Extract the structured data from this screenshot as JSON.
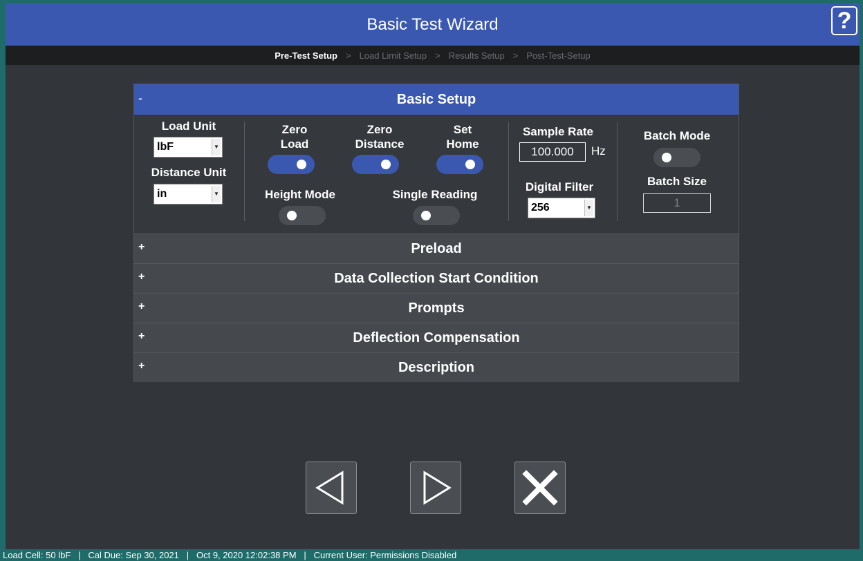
{
  "window": {
    "title": "Basic Test Wizard",
    "help_label": "?"
  },
  "breadcrumb": {
    "steps": [
      "Pre-Test Setup",
      "Load Limit Setup",
      "Results Setup",
      "Post-Test-Setup"
    ],
    "active_index": 0,
    "separator": ">"
  },
  "basic_setup": {
    "header": "Basic Setup",
    "toggle": "-",
    "load_unit": {
      "label": "Load Unit",
      "value": "lbF"
    },
    "distance_unit": {
      "label": "Distance Unit",
      "value": "in"
    },
    "zero_load": {
      "label_line1": "Zero",
      "label_line2": "Load",
      "on": true
    },
    "zero_distance": {
      "label_line1": "Zero",
      "label_line2": "Distance",
      "on": true
    },
    "set_home": {
      "label_line1": "Set",
      "label_line2": "Home",
      "on": true
    },
    "height_mode": {
      "label": "Height Mode",
      "on": false
    },
    "single_reading": {
      "label": "Single Reading",
      "on": false
    },
    "sample_rate": {
      "label": "Sample Rate",
      "value": "100.000",
      "unit": "Hz"
    },
    "digital_filter": {
      "label": "Digital Filter",
      "value": "256"
    },
    "batch_mode": {
      "label": "Batch Mode",
      "on": false
    },
    "batch_size": {
      "label": "Batch Size",
      "value": "1"
    }
  },
  "sections": [
    {
      "toggle": "+",
      "label": "Preload"
    },
    {
      "toggle": "+",
      "label": "Data Collection Start Condition"
    },
    {
      "toggle": "+",
      "label": "Prompts"
    },
    {
      "toggle": "+",
      "label": "Deflection Compensation"
    },
    {
      "toggle": "+",
      "label": "Description"
    }
  ],
  "nav": {
    "back_icon": "triangle-left-icon",
    "next_icon": "triangle-right-icon",
    "cancel_icon": "close-x-icon"
  },
  "status": {
    "load_cell": "Load Cell: 50 lbF",
    "cal_due": "Cal Due: Sep 30, 2021",
    "datetime": "Oct 9, 2020 12:02:38 PM",
    "current_user": "Current User: Permissions Disabled",
    "separator": "|"
  },
  "colors": {
    "accent": "#3a58b0",
    "background": "#323539",
    "desktop": "#1f6b6a"
  }
}
